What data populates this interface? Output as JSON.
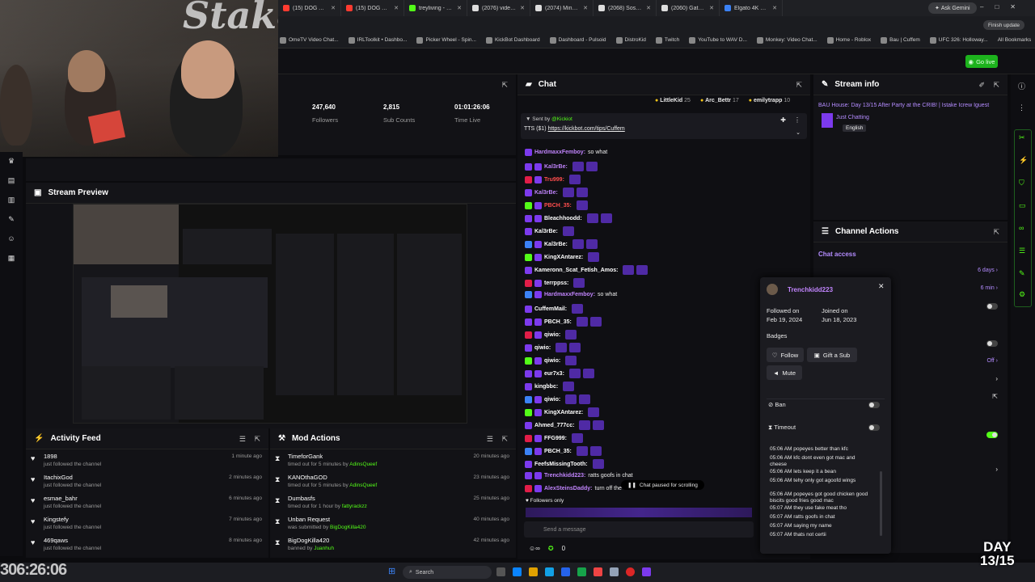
{
  "browser": {
    "tabs": [
      {
        "label": "(15) DOG AND DUI",
        "color": "#ff3b30"
      },
      {
        "label": "(15) DOG AND DUI",
        "color": "#ff3b30"
      },
      {
        "label": "treyliving - Watch th",
        "color": "#53fc18"
      },
      {
        "label": "(2076) video on X",
        "color": "#dddddd"
      },
      {
        "label": "(2074) MindForMMA",
        "color": "#dddddd"
      },
      {
        "label": "(2068) SosaGrimz o",
        "color": "#dddddd"
      },
      {
        "label": "(2060) Gatorade on",
        "color": "#dddddd"
      },
      {
        "label": "Elgato 4K X – Elgato",
        "color": "#3b82f6"
      }
    ],
    "ask_gemini": "Ask Gemini",
    "finish_update": "Finish update",
    "bookmarks": [
      "OmeTV Video Chat...",
      "IRLToolkit • Dashbo...",
      "Picker Wheel - Spin...",
      "KickBot Dashboard",
      "Dashboard - Pulsoid",
      "DistroKid",
      "Twitch",
      "YouTube to WAV D...",
      "Monkey: Video Chat...",
      "Home - Roblox",
      "Bau | Cuffem",
      "UFC 326: Holloway..."
    ],
    "all_bookmarks": "All Bookmarks"
  },
  "header": {
    "go_live": "Go live"
  },
  "stats": {
    "followers_value": "247,640",
    "followers_label": "Followers",
    "subs_value": "2,815",
    "subs_label": "Sub Counts",
    "time_value": "01:01:26:06",
    "time_label": "Time Live"
  },
  "preview": {
    "title": "Stream Preview"
  },
  "activity": {
    "title": "Activity Feed",
    "items": [
      {
        "name": "1898",
        "sub": "just followed the channel",
        "time": "1 minute ago"
      },
      {
        "name": "ItachixGod",
        "sub": "just followed the channel",
        "time": "2 minutes ago"
      },
      {
        "name": "esmae_bahr",
        "sub": "just followed the channel",
        "time": "6 minutes ago"
      },
      {
        "name": "Kingstefy",
        "sub": "just followed the channel",
        "time": "7 minutes ago"
      },
      {
        "name": "469qaws",
        "sub": "just followed the channel",
        "time": "8 minutes ago"
      }
    ]
  },
  "mod_actions": {
    "title": "Mod Actions",
    "items": [
      {
        "name": "TimeforGank",
        "sub": "timed out for 5 minutes by",
        "by": "AdinsQueef",
        "time": "20 minutes ago"
      },
      {
        "name": "KANOthaGOD",
        "sub": "timed out for 5 minutes by",
        "by": "AdinsQueef",
        "time": "23 minutes ago"
      },
      {
        "name": "Dumbasfs",
        "sub": "timed out for 1 hour by",
        "by": "fattyrackzz",
        "time": "25 minutes ago"
      },
      {
        "name": "Unban Request",
        "sub": "was submitted by",
        "by": "BigDogKilla420",
        "time": "40 minutes ago"
      },
      {
        "name": "BigDogKilla420",
        "sub": "banned by",
        "by": "Juanhuh",
        "time": "42 minutes ago"
      }
    ]
  },
  "chat": {
    "title": "Chat",
    "top_gifters": [
      {
        "name": "LittleKid",
        "count": "25"
      },
      {
        "name": "Arc_Bettr",
        "count": "17"
      },
      {
        "name": "emilytrapp",
        "count": "10"
      }
    ],
    "pinned_sent_by": "Sent by",
    "pinned_user": "@Kickiot",
    "pinned_text": "TTS ($1)",
    "pinned_link": "https://kickbot.com/tips/Cuffem",
    "messages": [
      {
        "user": "HardmaxxFemboy:",
        "text": "so what",
        "color": "#c084fc"
      },
      {
        "user": "Kal3rBe:",
        "text": "",
        "color": "#c084fc"
      },
      {
        "user": "Tru999:",
        "text": "",
        "color": "#ff4d4d"
      },
      {
        "user": "Kal3rBe:",
        "text": "",
        "color": "#c084fc"
      },
      {
        "user": "PBCH_35:",
        "text": "",
        "color": "#ff4d4d"
      },
      {
        "user": "Bleachhoodd:",
        "text": "",
        "color": "#ffffff"
      },
      {
        "user": "Kal3rBe:",
        "text": "",
        "color": "#ffffff"
      },
      {
        "user": "Kal3rBe:",
        "text": "",
        "color": "#ffffff"
      },
      {
        "user": "KingXAntarez:",
        "text": "",
        "color": "#ffffff"
      },
      {
        "user": "Kameronn_Scat_Fetish_Amos:",
        "text": "",
        "color": "#ffffff"
      },
      {
        "user": "terrppss:",
        "text": "",
        "color": "#ffffff"
      },
      {
        "user": "HardmaxxFemboy:",
        "text": "so what",
        "color": "#c084fc"
      },
      {
        "user": "CuffemMail:",
        "text": "",
        "color": "#ffffff"
      },
      {
        "user": "PBCH_35:",
        "text": "",
        "color": "#ffffff"
      },
      {
        "user": "qiwio:",
        "text": "",
        "color": "#ffffff"
      },
      {
        "user": "qiwio:",
        "text": "",
        "color": "#ffffff"
      },
      {
        "user": "qiwio:",
        "text": "",
        "color": "#ffffff"
      },
      {
        "user": "eur7x3:",
        "text": "",
        "color": "#ffffff"
      },
      {
        "user": "kingbbc:",
        "text": "",
        "color": "#ffffff"
      },
      {
        "user": "qiwio:",
        "text": "",
        "color": "#ffffff"
      },
      {
        "user": "KingXAntarez:",
        "text": "",
        "color": "#ffffff"
      },
      {
        "user": "Ahmed_777cc:",
        "text": "",
        "color": "#ffffff"
      },
      {
        "user": "FFG999:",
        "text": "",
        "color": "#ffffff"
      },
      {
        "user": "PBCH_35:",
        "text": "",
        "color": "#ffffff"
      },
      {
        "user": "FeefsMissingTooth:",
        "text": "",
        "color": "#ffffff"
      },
      {
        "user": "Trenchkidd223:",
        "text": "ratts goofs in chat",
        "color": "#c084fc"
      },
      {
        "user": "AlexSteinsDaddy:",
        "text": "turn off the",
        "color": "#c084fc"
      }
    ],
    "paused": "Chat paused for scrolling",
    "followers_only": "Followers only",
    "send_placeholder": "Send a message",
    "footer_count": "0"
  },
  "stream_info": {
    "title": "Stream info",
    "stream_title": "BAU House: Day 13/15 After Party at the CRIB! | Istake Icrew Iguest",
    "category": "Just Chatting",
    "language": "English"
  },
  "channel_actions": {
    "title": "Channel Actions",
    "chat_access": "Chat access",
    "rows": [
      {
        "value": "6 days"
      },
      {
        "value": "6 min"
      },
      {
        "value": "Off"
      }
    ]
  },
  "user_card": {
    "username": "Trenchkidd223",
    "followed_label": "Followed on",
    "followed_date": "Feb 19, 2024",
    "joined_label": "Joined on",
    "joined_date": "Jun 18, 2023",
    "badges_label": "Badges",
    "follow": "Follow",
    "gift": "Gift a Sub",
    "mute": "Mute",
    "ban": "Ban",
    "timeout": "Timeout",
    "log": [
      "05:06 AM popeyes better than kfc",
      "05:06 AM kfc dont even got mac and cheese",
      "05:06 AM lets keep it a bean",
      "05:06 AM tehy only got agoofd wings",
      "05:06 AM popeyes got good chicken good biscits good fries good mac",
      "05:07 AM they use fake meat tho",
      "05:07 AM ratts goofs in chat",
      "05:07 AM saying my name",
      "05:07 AM thats not certii"
    ]
  },
  "overlay": {
    "timer": "306:26:06",
    "day_line1": "DAY",
    "day_line2": "13/15"
  },
  "taskbar": {
    "search": "Search"
  }
}
